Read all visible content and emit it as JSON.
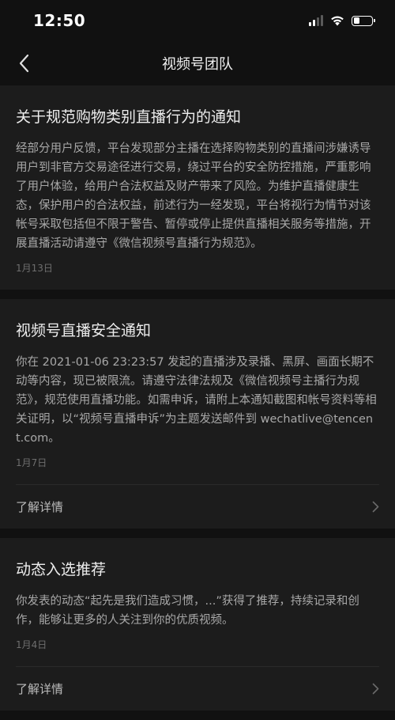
{
  "status_bar": {
    "time": "12:50"
  },
  "nav": {
    "title": "视频号团队"
  },
  "cards": [
    {
      "title": "关于规范购物类别直播行为的通知",
      "text": "经部分用户反馈，平台发现部分主播在选择购物类别的直播间涉嫌诱导用户到非官方交易途径进行交易，绕过平台的安全防控措施，严重影响了用户体验，给用户合法权益及财产带来了风险。为维护直播健康生态，保护用户的合法权益，前述行为一经发现，平台将视行为情节对该帐号采取包括但不限于警告、暂停或停止提供直播相关服务等措施，开展直播活动请遵守《微信视频号直播行为规范》。",
      "date": "1月13日"
    },
    {
      "title": "视频号直播安全通知",
      "text": "你在 2021-01-06 23:23:57 发起的直播涉及录播、黑屏、画面长期不动等内容，现已被限流。请遵守法律法规及《微信视频号主播行为规范》，规范使用直播功能。如需申诉，请附上本通知截图和帐号资料等相关证明，以“视频号直播申诉”为主题发送邮件到 wechatlive@tencent.com。",
      "date": "1月7日",
      "detail_label": "了解详情"
    },
    {
      "title": "动态入选推荐",
      "text": "你发表的动态“起先是我们造成习惯，...”获得了推荐，持续记录和创作，能够让更多的人关注到你的优质视频。",
      "date": "1月4日",
      "detail_label": "了解详情"
    }
  ]
}
